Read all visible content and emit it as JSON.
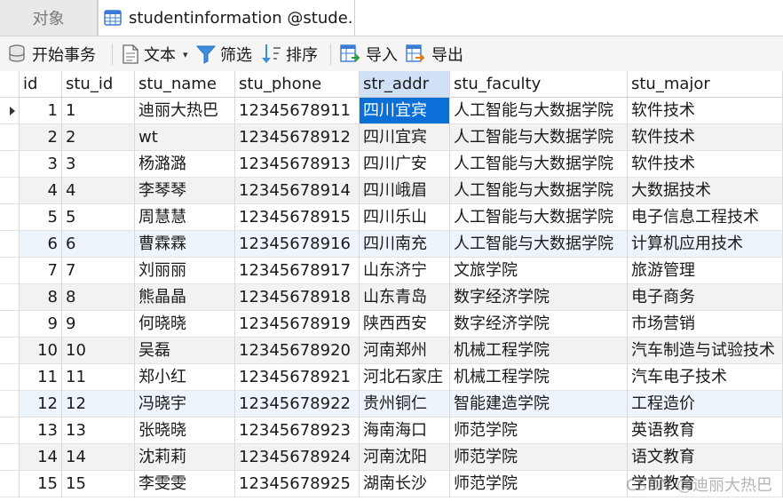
{
  "tabs": {
    "objects_label": "对象",
    "table_label": "studentinformation @stude..."
  },
  "toolbar": {
    "begin_transaction": "开始事务",
    "text": "文本",
    "filter": "筛选",
    "sort": "排序",
    "import": "导入",
    "export": "导出"
  },
  "table": {
    "columns": [
      "id",
      "stu_id",
      "stu_name",
      "stu_phone",
      "str_addr",
      "stu_faculty",
      "stu_major"
    ],
    "rows": [
      [
        "1",
        "1",
        "迪丽大热巴",
        "12345678911",
        "四川宜宾",
        "人工智能与大数据学院",
        "软件技术"
      ],
      [
        "2",
        "2",
        "wt",
        "12345678912",
        "四川宜宾",
        "人工智能与大数据学院",
        "软件技术"
      ],
      [
        "3",
        "3",
        "杨潞潞",
        "12345678913",
        "四川广安",
        "人工智能与大数据学院",
        "软件技术"
      ],
      [
        "4",
        "4",
        "李琴琴",
        "12345678914",
        "四川峨眉",
        "人工智能与大数据学院",
        "大数据技术"
      ],
      [
        "5",
        "5",
        "周慧慧",
        "12345678915",
        "四川乐山",
        "人工智能与大数据学院",
        "电子信息工程技术"
      ],
      [
        "6",
        "6",
        "曹霖霖",
        "12345678916",
        "四川南充",
        "人工智能与大数据学院",
        "计算机应用技术"
      ],
      [
        "7",
        "7",
        "刘丽丽",
        "12345678917",
        "山东济宁",
        "文旅学院",
        "旅游管理"
      ],
      [
        "8",
        "8",
        "熊晶晶",
        "12345678918",
        "山东青岛",
        "数字经济学院",
        "电子商务"
      ],
      [
        "9",
        "9",
        "何晓晓",
        "12345678919",
        "陕西西安",
        "数字经济学院",
        "市场营销"
      ],
      [
        "10",
        "10",
        "吴磊",
        "12345678920",
        "河南郑州",
        "机械工程学院",
        "汽车制造与试验技术"
      ],
      [
        "11",
        "11",
        "郑小红",
        "12345678921",
        "河北石家庄",
        "机械工程学院",
        "汽车电子技术"
      ],
      [
        "12",
        "12",
        "冯晓宇",
        "12345678922",
        "贵州铜仁",
        "智能建造学院",
        "工程造价"
      ],
      [
        "13",
        "13",
        "张晓晓",
        "12345678923",
        "海南海口",
        "师范学院",
        "英语教育"
      ],
      [
        "14",
        "14",
        "沈莉莉",
        "12345678924",
        "河南沈阳",
        "师范学院",
        "语文教育"
      ],
      [
        "15",
        "15",
        "李雯雯",
        "12345678925",
        "湖南长沙",
        "师范学院",
        "学前教育"
      ]
    ]
  },
  "watermark": "CSDN @迪丽大热巴",
  "colors": {
    "selection": "#0a6fd6",
    "header_selected": "#cfe0f7",
    "row_alt": "#f2f2f2"
  }
}
